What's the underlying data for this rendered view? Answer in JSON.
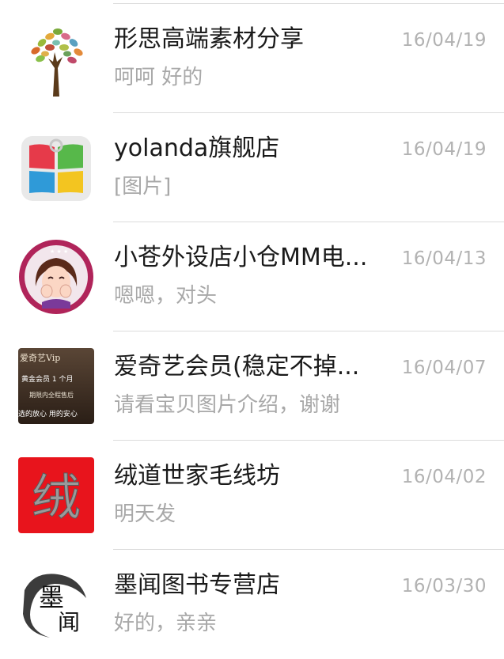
{
  "conversations": [
    {
      "name": "形思高端素材分享",
      "time": "16/04/19",
      "message": "呵呵 好的",
      "avatar_icon": "colorful-tree-icon"
    },
    {
      "name": "yolanda旗舰店",
      "time": "16/04/19",
      "message": "[图片]",
      "avatar_icon": "windows-tiles-bag-icon"
    },
    {
      "name": "小苍外设店小仓MM电...",
      "time": "16/04/13",
      "message": "嗯嗯，对头",
      "avatar_icon": "cartoon-girl-icon"
    },
    {
      "name": "爱奇艺会员(稳定不掉...",
      "time": "16/04/07",
      "message": "请看宝贝图片介绍，谢谢",
      "avatar_icon": "vip-card-icon",
      "avatar_text": {
        "line1": "爱奇艺Vip",
        "line2": "黄金会员  1 个月",
        "line3": "期限内全程售后",
        "line4": "选的放心 用的安心"
      }
    },
    {
      "name": "绒道世家毛线坊",
      "time": "16/04/02",
      "message": "明天发",
      "avatar_icon": "red-character-icon",
      "avatar_text": {
        "char": "绒"
      }
    },
    {
      "name": "墨闻图书专营店",
      "time": "16/03/30",
      "message": "好的，亲亲",
      "avatar_icon": "ink-calligraphy-icon",
      "avatar_text": {
        "char1": "墨",
        "char2": "闻"
      }
    }
  ]
}
